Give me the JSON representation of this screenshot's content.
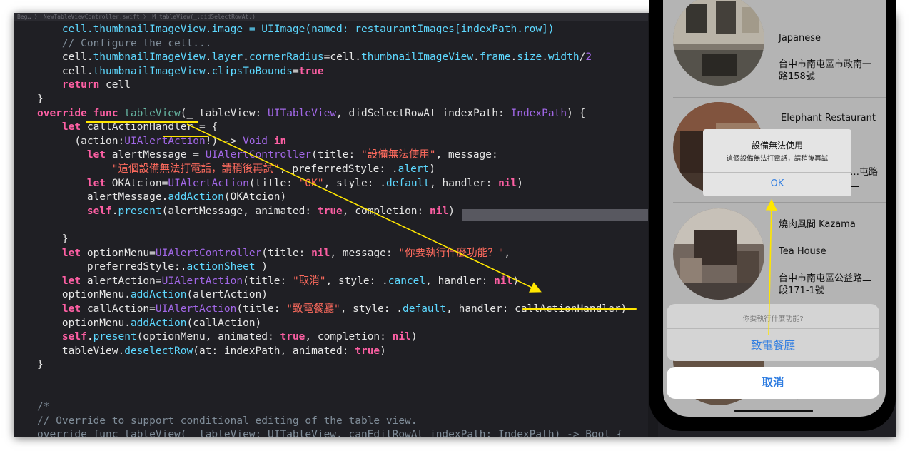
{
  "editor": {
    "breadcrumb": "Beg… 〉 NewTableViewController.swift 〉 M tableView(_:didSelectRowAt:)",
    "code_lines": [
      [
        [
          "pl",
          "    "
        ],
        [
          "pr",
          "cell.thumbnailImageView.image = UIImage(named: restaurantImages[indexPath.row])"
        ]
      ],
      [
        [
          "pl",
          "    "
        ],
        [
          "cmt",
          "// Configure the cell..."
        ]
      ],
      [
        [
          "pl",
          "    cell."
        ],
        [
          "pr",
          "thumbnailImageView"
        ],
        [
          "pl",
          "."
        ],
        [
          "pr",
          "layer"
        ],
        [
          "pl",
          "."
        ],
        [
          "pr",
          "cornerRadius"
        ],
        [
          "pl",
          "=cell."
        ],
        [
          "pr",
          "thumbnailImageView"
        ],
        [
          "pl",
          "."
        ],
        [
          "pr",
          "frame"
        ],
        [
          "pl",
          "."
        ],
        [
          "pr",
          "size"
        ],
        [
          "pl",
          "."
        ],
        [
          "pr",
          "width"
        ],
        [
          "pl",
          "/"
        ],
        [
          "ty",
          "2"
        ]
      ],
      [
        [
          "pl",
          "    cell."
        ],
        [
          "pr",
          "thumbnailImageView"
        ],
        [
          "pl",
          "."
        ],
        [
          "pr",
          "clipsToBounds"
        ],
        [
          "pl",
          "="
        ],
        [
          "kw",
          "true"
        ]
      ],
      [
        [
          "pl",
          "    "
        ],
        [
          "kw",
          "return"
        ],
        [
          "pl",
          " cell"
        ]
      ],
      [
        [
          "pl",
          "}"
        ]
      ],
      [
        [
          "kw",
          "override func "
        ],
        [
          "fn",
          "tableView"
        ],
        [
          "pl",
          "(_ tableView: "
        ],
        [
          "ty",
          "UITableView"
        ],
        [
          "pl",
          ", didSelectRowAt indexPath: "
        ],
        [
          "ty",
          "IndexPath"
        ],
        [
          "pl",
          ") {"
        ]
      ],
      [
        [
          "pl",
          "    "
        ],
        [
          "kw",
          "let"
        ],
        [
          "pl",
          " callActionHandler = {"
        ]
      ],
      [
        [
          "pl",
          "      (action:"
        ],
        [
          "ty",
          "UIAlertAction"
        ],
        [
          "pl",
          "!) -> "
        ],
        [
          "ty",
          "Void"
        ],
        [
          "pl",
          " "
        ],
        [
          "kw",
          "in"
        ]
      ],
      [
        [
          "pl",
          "        "
        ],
        [
          "kw",
          "let"
        ],
        [
          "pl",
          " alertMessage = "
        ],
        [
          "ty",
          "UIAlertController"
        ],
        [
          "pl",
          "(title: "
        ],
        [
          "str",
          "\"設備無法使用\""
        ],
        [
          "pl",
          ", message:"
        ]
      ],
      [
        [
          "pl",
          "            "
        ],
        [
          "str",
          "\"這個設備無法打電話，請稍後再試\""
        ],
        [
          "pl",
          ", preferredStyle: ."
        ],
        [
          "pr",
          "alert"
        ],
        [
          "pl",
          ")"
        ]
      ],
      [
        [
          "pl",
          "        "
        ],
        [
          "kw",
          "let"
        ],
        [
          "pl",
          " OKAtcion="
        ],
        [
          "ty",
          "UIAlertAction"
        ],
        [
          "pl",
          "(title: "
        ],
        [
          "str",
          "\"OK\""
        ],
        [
          "pl",
          ", style: ."
        ],
        [
          "pr",
          "default"
        ],
        [
          "pl",
          ", handler: "
        ],
        [
          "kw",
          "nil"
        ],
        [
          "pl",
          ")"
        ]
      ],
      [
        [
          "pl",
          "        alertMessage."
        ],
        [
          "pr",
          "addAction"
        ],
        [
          "pl",
          "(OKAtcion)"
        ]
      ],
      [
        [
          "pl",
          "        "
        ],
        [
          "kw",
          "self"
        ],
        [
          "pl",
          "."
        ],
        [
          "pr",
          "present"
        ],
        [
          "pl",
          "(alertMessage, animated: "
        ],
        [
          "kw",
          "true"
        ],
        [
          "pl",
          ", completion: "
        ],
        [
          "kw",
          "nil"
        ],
        [
          "pl",
          ")"
        ]
      ],
      [
        [
          "pl",
          ""
        ]
      ],
      [
        [
          "pl",
          "    }"
        ]
      ],
      [
        [
          "pl",
          "    "
        ],
        [
          "kw",
          "let"
        ],
        [
          "pl",
          " optionMenu="
        ],
        [
          "ty",
          "UIAlertController"
        ],
        [
          "pl",
          "(title: "
        ],
        [
          "kw",
          "nil"
        ],
        [
          "pl",
          ", message: "
        ],
        [
          "str",
          "\"你要執行什麼功能？\""
        ],
        [
          "pl",
          ","
        ]
      ],
      [
        [
          "pl",
          "        preferredStyle:."
        ],
        [
          "pr",
          "actionSheet"
        ],
        [
          "pl",
          " )"
        ]
      ],
      [
        [
          "pl",
          "    "
        ],
        [
          "kw",
          "let"
        ],
        [
          "pl",
          " alertAction="
        ],
        [
          "ty",
          "UIAlertAction"
        ],
        [
          "pl",
          "(title: "
        ],
        [
          "str",
          "\"取消\""
        ],
        [
          "pl",
          ", style: ."
        ],
        [
          "pr",
          "cancel"
        ],
        [
          "pl",
          ", handler: "
        ],
        [
          "kw",
          "nil"
        ],
        [
          "pl",
          ")"
        ]
      ],
      [
        [
          "pl",
          "    optionMenu."
        ],
        [
          "pr",
          "addAction"
        ],
        [
          "pl",
          "(alertAction)"
        ]
      ],
      [
        [
          "pl",
          "    "
        ],
        [
          "kw",
          "let"
        ],
        [
          "pl",
          " callAction="
        ],
        [
          "ty",
          "UIAlertAction"
        ],
        [
          "pl",
          "(title: "
        ],
        [
          "str",
          "\"致電餐廳\""
        ],
        [
          "pl",
          ", style: ."
        ],
        [
          "pr",
          "default"
        ],
        [
          "pl",
          ", handler: callActionHandler)"
        ]
      ],
      [
        [
          "pl",
          "    optionMenu."
        ],
        [
          "pr",
          "addAction"
        ],
        [
          "pl",
          "(callAction)"
        ]
      ],
      [
        [
          "pl",
          "    "
        ],
        [
          "kw",
          "self"
        ],
        [
          "pl",
          "."
        ],
        [
          "pr",
          "present"
        ],
        [
          "pl",
          "(optionMenu, animated: "
        ],
        [
          "kw",
          "true"
        ],
        [
          "pl",
          ", completion: "
        ],
        [
          "kw",
          "nil"
        ],
        [
          "pl",
          ")"
        ]
      ],
      [
        [
          "pl",
          "    tableView."
        ],
        [
          "pr",
          "deselectRow"
        ],
        [
          "pl",
          "(at: indexPath, animated: "
        ],
        [
          "kw",
          "true"
        ],
        [
          "pl",
          ")"
        ]
      ],
      [
        [
          "pl",
          "}"
        ]
      ],
      [
        [
          "pl",
          ""
        ]
      ],
      [
        [
          "pl",
          ""
        ]
      ],
      [
        [
          "cmt",
          "/*"
        ]
      ],
      [
        [
          "cmt",
          "// Override to support conditional editing of the table view."
        ]
      ],
      [
        [
          "cmt",
          "override func tableView(_ tableView: UITableView, canEditRowAt indexPath: IndexPath) -> Bool {"
        ]
      ]
    ]
  },
  "simulator": {
    "cells": [
      {
        "name": "Japanese",
        "address": "台中市南屯區市政南一路158號"
      },
      {
        "name": "Elephant Restaurant",
        "address": "…屯路二"
      },
      {
        "name": "燒肉風間 Kazama",
        "type": "Tea House",
        "address": "台中市南屯區公益路二段171-1號"
      }
    ],
    "alert": {
      "title": "設備無法使用",
      "message": "這個設備無法打電話，請稍後再試",
      "ok": "OK"
    },
    "action_sheet": {
      "message": "你要執行什麼功能?",
      "call": "致電餐廳",
      "cancel": "取消"
    }
  },
  "colors": {
    "editor_bg": "#1f1f24",
    "keyword": "#fc5fa3",
    "string": "#fc6a5d",
    "type": "#a167e6",
    "property": "#5dd8ff",
    "annotation": "#ffe600",
    "ios_blue": "#2f7de1"
  }
}
